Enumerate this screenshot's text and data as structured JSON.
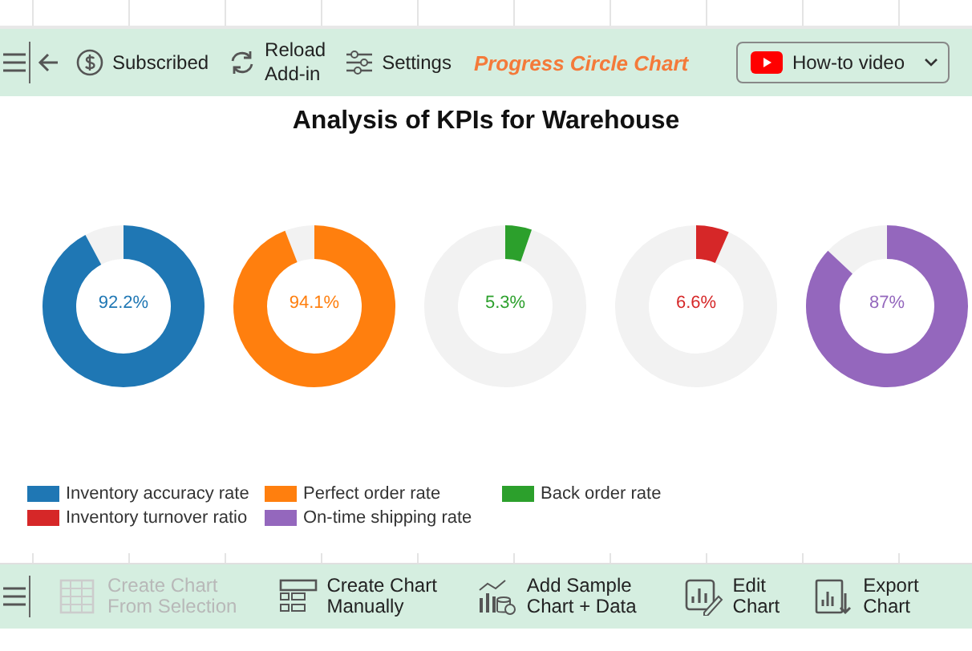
{
  "top_toolbar": {
    "buttons": [
      {
        "kind": "subscribed",
        "label": "Subscribed"
      },
      {
        "kind": "reload",
        "label": "Reload\nAdd-in"
      },
      {
        "kind": "settings",
        "label": "Settings"
      }
    ],
    "app_title": "Progress Circle Chart",
    "video_dropdown": {
      "label": "How-to video"
    }
  },
  "chart": {
    "title": "Analysis of KPIs for Warehouse",
    "kpis": [
      {
        "reading": "92.2%",
        "color": "#1f77b4"
      },
      {
        "reading": "94.1%",
        "color": "#ff7f0e"
      },
      {
        "reading": "5.3%",
        "color": "#2ca02c"
      },
      {
        "reading": "6.6%",
        "color": "#d62728"
      },
      {
        "reading": "87%",
        "color": "#9467bd"
      }
    ],
    "legend": [
      {
        "label": "Inventory accuracy rate",
        "color": "#1f77b4"
      },
      {
        "label": "Perfect order rate",
        "color": "#ff7f0e"
      },
      {
        "label": "Back order rate",
        "color": "#2ca02c"
      },
      {
        "label": "Inventory turnover ratio",
        "color": "#d62728"
      },
      {
        "label": "On-time shipping rate",
        "color": "#9467bd"
      }
    ]
  },
  "bottom_toolbar": {
    "buttons": [
      {
        "kind": "from-selection",
        "label": "Create Chart\nFrom Selection",
        "disabled": true
      },
      {
        "kind": "manual",
        "label": "Create Chart\nManually",
        "disabled": false
      },
      {
        "kind": "sample",
        "label": "Add Sample\nChart + Data",
        "disabled": false
      },
      {
        "kind": "edit",
        "label": "Edit\nChart",
        "disabled": false
      },
      {
        "kind": "export",
        "label": "Export\nChart",
        "disabled": false
      }
    ]
  }
}
